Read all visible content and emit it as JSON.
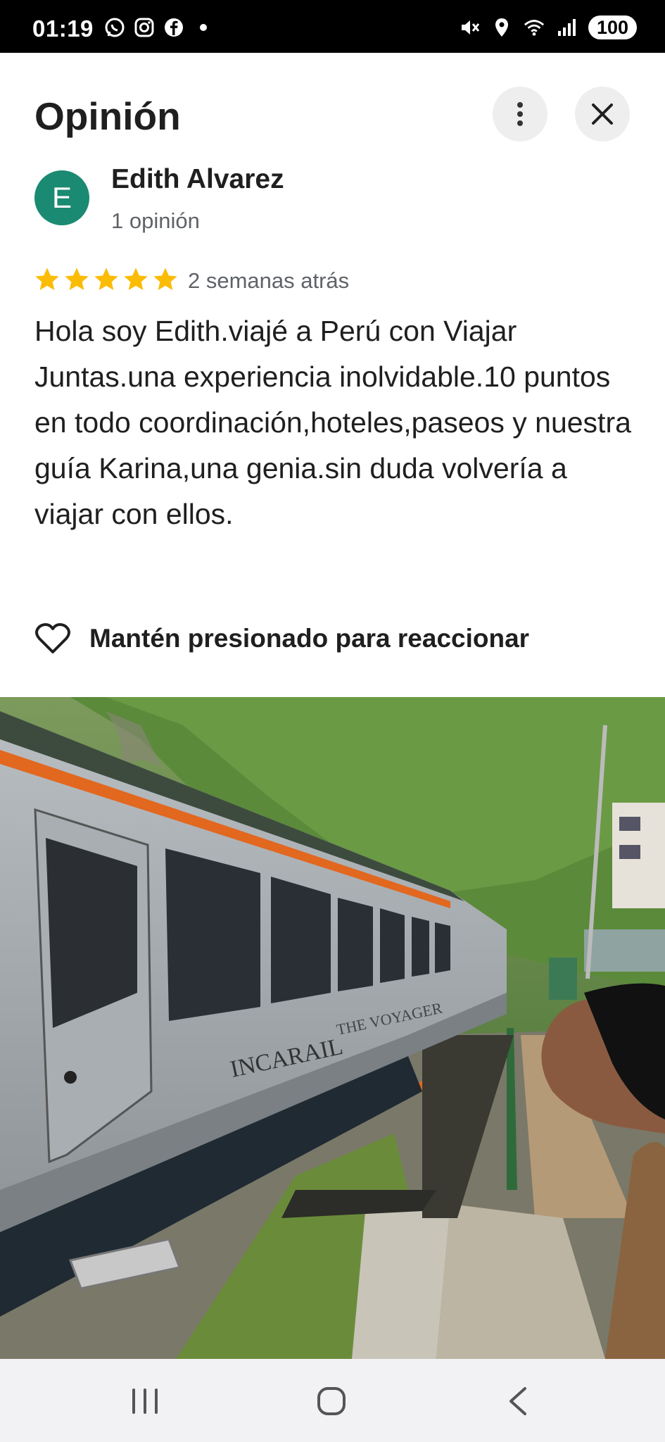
{
  "status_bar": {
    "time": "01:19",
    "left_icons": [
      "whatsapp-icon",
      "instagram-icon",
      "facebook-icon",
      "dot-icon"
    ],
    "right_icons": [
      "mute-icon",
      "location-icon",
      "wifi-icon",
      "signal-icon"
    ],
    "battery": "100"
  },
  "header": {
    "title": "Opinión",
    "more_icon": "more-vert-icon",
    "close_icon": "close-icon"
  },
  "author": {
    "initial": "E",
    "name": "Edith Alvarez",
    "reviews_count": "1 opinión",
    "avatar_color": "#1b8a72"
  },
  "review": {
    "rating": 5,
    "max_rating": 5,
    "star_color": "#fbbc04",
    "date": "2 semanas atrás",
    "text": "Hola soy Edith.viajé a Perú con Viajar Juntas.una experiencia inolvidable.10 puntos en todo coordinación,hoteles,paseos y nuestra guía Karina,una genia.sin duda volvería a viajar con ellos."
  },
  "reaction": {
    "icon": "heart-outline-icon",
    "label": "Mantén presionado para reaccionar"
  },
  "photo": {
    "train_text_1": "INCARAIL",
    "train_text_2": "THE VOYAGER"
  },
  "nav_bar": {
    "icons": [
      "recents-icon",
      "home-icon",
      "back-icon"
    ]
  }
}
